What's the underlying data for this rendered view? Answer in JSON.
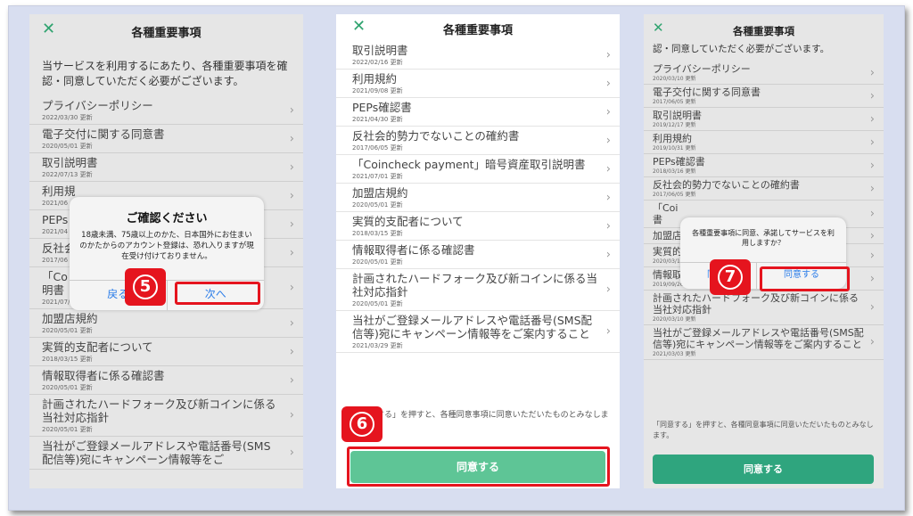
{
  "panel1": {
    "title": "各種重要事項",
    "intro": "当サービスを利用するにあたり、各種重要事項を確認・同意していただく必要がございます。",
    "items": [
      {
        "name": "プライバシーポリシー",
        "date": "2022/03/30 更新"
      },
      {
        "name": "電子交付に関する同意書",
        "date": "2020/05/01 更新"
      },
      {
        "name": "取引説明書",
        "date": "2022/07/13 更新"
      },
      {
        "name": "利用規",
        "date": "2021/06"
      },
      {
        "name": "PEPs",
        "date": "2021/04"
      },
      {
        "name": "反社会",
        "date": "2017/06"
      },
      {
        "name": "「Co",
        "name2": "明書",
        "date": "2021/07/01 更新"
      },
      {
        "name": "加盟店規約",
        "date": "2020/05/01 更新"
      },
      {
        "name": "実質的支配者について",
        "date": "2018/03/15 更新"
      },
      {
        "name": "情報取得者に係る確認書",
        "date": "2020/05/01 更新"
      },
      {
        "name": "計画されたハードフォーク及び新コインに係る当社対応指針",
        "date": "2020/05/01 更新"
      },
      {
        "name": "当社がご登録メールアドレスや電話番号(SMS配信等)宛にキャンペーン情報等をご",
        "date": ""
      }
    ],
    "dialog": {
      "title": "ご確認ください",
      "message": "18歳未満、75歳以上のかた、日本国外にお住まいのかたからのアカウント登録は、恐れ入りますが現在受け付けておりません。",
      "back": "戻る",
      "next": "次へ"
    },
    "badge": "5"
  },
  "panel2": {
    "title": "各種重要事項",
    "items": [
      {
        "name": "取引説明書",
        "date": "2022/02/16 更新"
      },
      {
        "name": "利用規約",
        "date": "2021/09/08 更新"
      },
      {
        "name": "PEPs確認書",
        "date": "2021/04/30 更新"
      },
      {
        "name": "反社会的勢力でないことの確約書",
        "date": "2017/06/05 更新"
      },
      {
        "name": "「Coincheck payment」暗号資産取引説明書",
        "date": "2021/07/01 更新"
      },
      {
        "name": "加盟店規約",
        "date": "2020/05/01 更新"
      },
      {
        "name": "実質的支配者について",
        "date": "2018/03/15 更新"
      },
      {
        "name": "情報取得者に係る確認書",
        "date": "2020/05/01 更新"
      },
      {
        "name": "計画されたハードフォーク及び新コインに係る当社対応指針",
        "date": "2020/05/01 更新"
      },
      {
        "name": "当社がご登録メールアドレスや電話番号(SMS配信等)宛にキャンペーン情報等をご案内すること",
        "date": "2021/03/29 更新"
      }
    ],
    "footnote": "「同意する」を押すと、各種同意事項に同意いただいたものとみなします。",
    "agree": "同意する",
    "badge": "6"
  },
  "panel3": {
    "title": "各種重要事項",
    "intro": "認・同意していただく必要がございます。",
    "items": [
      {
        "name": "プライバシーポリシー",
        "date": "2020/03/10 更新"
      },
      {
        "name": "電子交付に関する同意書",
        "date": "2017/06/05 更新"
      },
      {
        "name": "取引説明書",
        "date": "2019/12/17 更新"
      },
      {
        "name": "利用規約",
        "date": "2019/10/31 更新"
      },
      {
        "name": "PEPs確認書",
        "date": "2018/03/16 更新"
      },
      {
        "name": "反社会的勢力でないことの確約書",
        "date": "2017/06/05 更新"
      },
      {
        "name": "「Coi",
        "name2": "書",
        "date": ""
      },
      {
        "name": "加盟店",
        "date": ""
      },
      {
        "name": "実質的支配者について",
        "date": "2020/03/10 更新"
      },
      {
        "name": "情報取得者に係る確認書",
        "date": "2019/09/26 更新"
      },
      {
        "name": "計画されたハードフォーク及び新コインに係る当社対応指針",
        "date": "2020/03/10 更新"
      },
      {
        "name": "当社がご登録メールアドレスや電話番号(SMS配信等)宛にキャンペーン情報等をご案内すること",
        "date": "2021/03/03 更新"
      }
    ],
    "dialog": {
      "message": "各種重要事項に同意、承諾してサービスを利用しますか？",
      "cancel": "同",
      "agree": "同意する"
    },
    "footnote": "「同意する」を押すと、各種同意事項に同意いただいたものとみなします。",
    "agree": "同意する",
    "badge": "7"
  }
}
